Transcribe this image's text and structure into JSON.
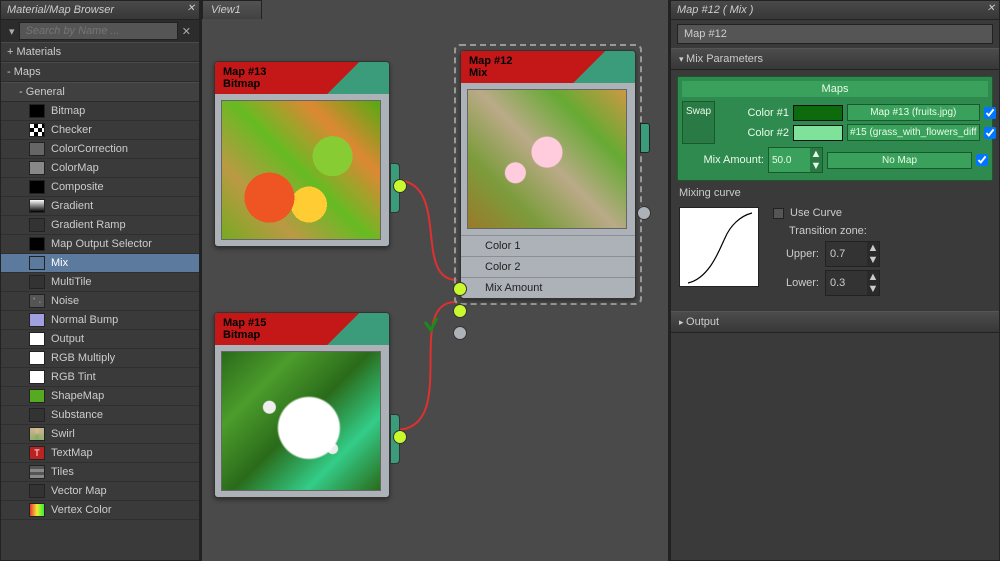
{
  "browser": {
    "title": "Material/Map Browser",
    "search_placeholder": "Search by Name ...",
    "materials_head": "+ Materials",
    "maps_head": "- Maps",
    "general_head": "- General",
    "items": [
      {
        "label": "Bitmap",
        "sw": "#000"
      },
      {
        "label": "Checker",
        "sw": "checker"
      },
      {
        "label": "ColorCorrection",
        "sw": "#666"
      },
      {
        "label": "ColorMap",
        "sw": "#888"
      },
      {
        "label": "Composite",
        "sw": "#000"
      },
      {
        "label": "Gradient",
        "sw": "grad"
      },
      {
        "label": "Gradient Ramp",
        "sw": "#333"
      },
      {
        "label": "Map Output Selector",
        "sw": "#000"
      },
      {
        "label": "Mix",
        "sw": "#5c7a9e",
        "selected": true
      },
      {
        "label": "MultiTile",
        "sw": "#333"
      },
      {
        "label": "Noise",
        "sw": "noise"
      },
      {
        "label": "Normal Bump",
        "sw": "#a0a0e0"
      },
      {
        "label": "Output",
        "sw": "#fff"
      },
      {
        "label": "RGB Multiply",
        "sw": "#fff"
      },
      {
        "label": "RGB Tint",
        "sw": "#fff"
      },
      {
        "label": "ShapeMap",
        "sw": "#5a2"
      },
      {
        "label": "Substance",
        "sw": "#333"
      },
      {
        "label": "Swirl",
        "sw": "swirl"
      },
      {
        "label": "TextMap",
        "sw": "text"
      },
      {
        "label": "Tiles",
        "sw": "tiles"
      },
      {
        "label": "Vector Map",
        "sw": "#333"
      },
      {
        "label": "Vertex Color",
        "sw": "vcol"
      }
    ]
  },
  "view": {
    "tab": "View1"
  },
  "nodes": {
    "n13": {
      "title1": "Map #13",
      "title2": "Bitmap"
    },
    "n15": {
      "title1": "Map #15",
      "title2": "Bitmap"
    },
    "n12": {
      "title1": "Map #12",
      "title2": "Mix",
      "slot1": "Color 1",
      "slot2": "Color 2",
      "slot3": "Mix Amount"
    }
  },
  "props": {
    "header": "Map #12  ( Mix )",
    "name": "Map #12",
    "rollout1": "Mix Parameters",
    "maps_label": "Maps",
    "swap": "Swap",
    "color1_label": "Color #1",
    "color2_label": "Color #2",
    "color1_hex": "#0d6b0d",
    "color2_hex": "#7ee29a",
    "map1": "Map #13 (fruits.jpg)",
    "map2": "#15 (grass_with_flowers_diff",
    "mixamt_label": "Mix Amount:",
    "mixamt": "50.0",
    "nomap": "No Map",
    "curve_label": "Mixing curve",
    "use_curve": "Use Curve",
    "tzone": "Transition zone:",
    "upper_label": "Upper:",
    "upper": "0.7",
    "lower_label": "Lower:",
    "lower": "0.3",
    "rollout2": "Output"
  }
}
